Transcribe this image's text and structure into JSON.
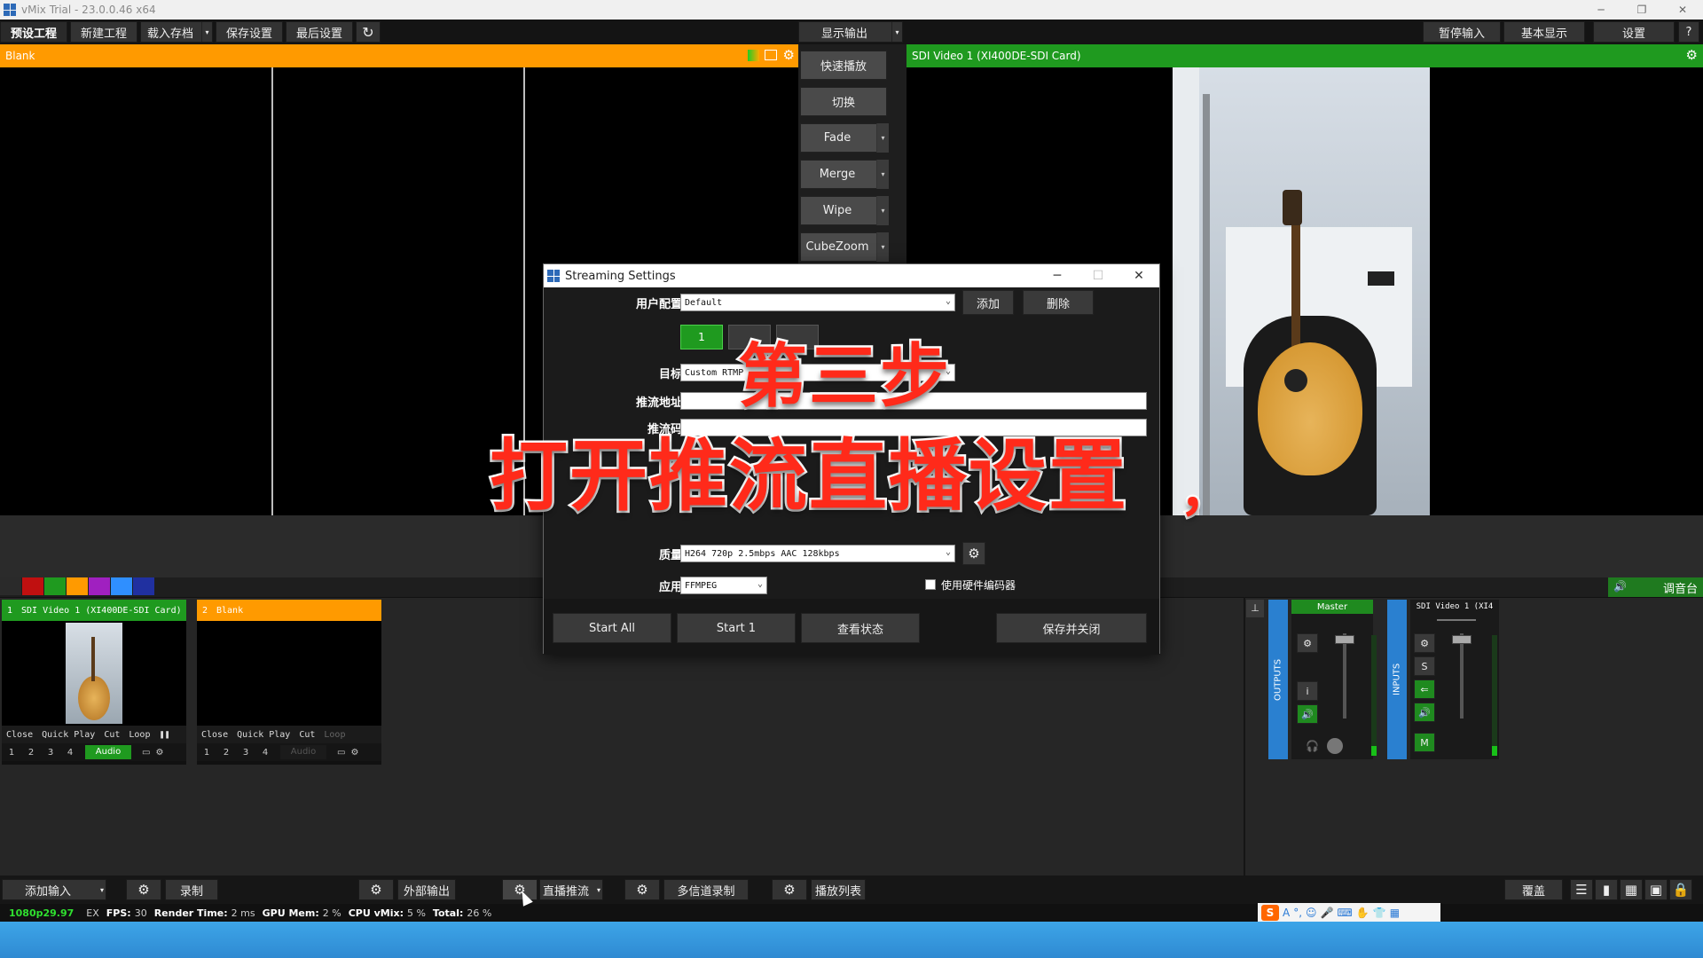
{
  "window": {
    "title": "vMix Trial - 23.0.0.46 x64",
    "min": "─",
    "max": "❐",
    "close": "✕"
  },
  "toolbar": {
    "items": [
      "预设工程",
      "新建工程",
      "载入存档",
      "保存设置",
      "最后设置"
    ],
    "refresh": "↻",
    "show_output": "显示输出",
    "right": [
      "暂停输入",
      "基本显示",
      "设置"
    ],
    "help": "?"
  },
  "preview": {
    "title": "Blank"
  },
  "output": {
    "title": "SDI Video 1 (XI400DE-SDI Card)"
  },
  "transitions": {
    "quick_play": "快速播放",
    "cut": "切换",
    "items": [
      "Fade",
      "Merge",
      "Wipe",
      "CubeZoom"
    ]
  },
  "colors": {
    "preview": "#ff9a00",
    "output": "#1f9a1f",
    "swatches": [
      "#2a2a2a",
      "#c01010",
      "#1f9a1f",
      "#ff9a00",
      "#a020c0",
      "#2f8fff",
      "#2030a0"
    ]
  },
  "mixer_button": "调音台",
  "inputs": [
    {
      "num": "1",
      "name": "SDI Video 1 (XI400DE-SDI Card)",
      "color": "#1f9a1f",
      "controls": [
        "Close",
        "Quick Play",
        "Cut",
        "Loop"
      ],
      "audio": "Audio"
    },
    {
      "num": "2",
      "name": "Blank",
      "color": "#ff9a00",
      "controls": [
        "Close",
        "Quick Play",
        "Cut",
        "Loop"
      ],
      "audio": "Audio"
    }
  ],
  "overlay_numbers": [
    "1",
    "2",
    "3",
    "4"
  ],
  "audio_mixer": {
    "outputs_label": "OUTPUTS",
    "inputs_label": "INPUTS",
    "master": "Master",
    "input1": "SDI Video 1 (XI4",
    "btn_i": "i",
    "btn_s": "S",
    "btn_m": "M"
  },
  "dialog": {
    "title": "Streaming Settings",
    "profile_label": "用户配置",
    "profile_value": "Default",
    "add": "添加",
    "delete": "删除",
    "tab1": "1",
    "target_label": "目标",
    "target_value": "Custom RTMP",
    "url_label": "推流地址",
    "key_label": "推流码",
    "quality_label": "质量",
    "quality_value": "H264 720p 2.5mbps AAC 128kbps",
    "app_label": "应用",
    "app_value": "FFMPEG",
    "hw_label": "使用硬件编码器",
    "start_all": "Start All",
    "start_1": "Start 1",
    "status": "查看状态",
    "save_close": "保存并关闭"
  },
  "captions": {
    "step": "第三步",
    "line": "打开推流直播设置",
    "comma": "，"
  },
  "bottombar": {
    "add_input": "添加输入",
    "record": "录制",
    "external": "外部输出",
    "stream": "直播推流",
    "multicorder": "多信道录制",
    "playlist": "播放列表",
    "overlay": "覆盖"
  },
  "status": {
    "resolution": "1080p29.97",
    "ex": "EX",
    "fps_label": "FPS:",
    "fps": "30",
    "render_label": "Render Time:",
    "render": "2 ms",
    "gpu_label": "GPU Mem:",
    "gpu": "2 %",
    "cpu_label": "CPU vMix:",
    "cpu": "5 %",
    "total_label": "Total:",
    "total": "26 %"
  },
  "ime": {
    "logo": "S",
    "a": "A"
  }
}
